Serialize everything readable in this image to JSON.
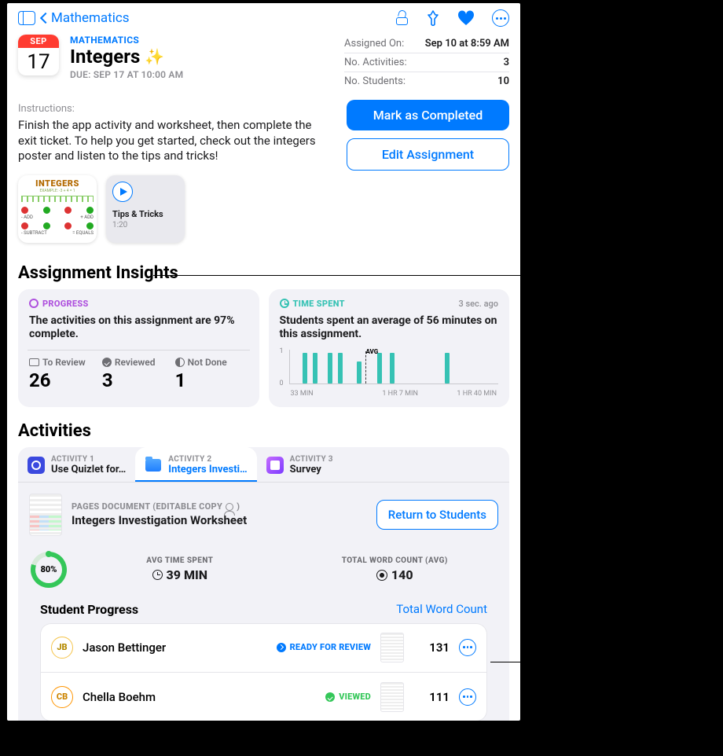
{
  "nav": {
    "back_label": "Mathematics"
  },
  "calendar": {
    "month": "SEP",
    "day": "17"
  },
  "header": {
    "eyebrow": "MATHEMATICS",
    "title": "Integers",
    "due": "DUE: SEP 17 AT 10:00 AM"
  },
  "meta": {
    "assigned_label": "Assigned On:",
    "assigned_value": "Sep 10 at 8:59 AM",
    "activities_label": "No. Activities:",
    "activities_value": "3",
    "students_label": "No. Students:",
    "students_value": "10"
  },
  "buttons": {
    "complete": "Mark as Completed",
    "edit": "Edit Assignment",
    "return_students": "Return to Students"
  },
  "instructions": {
    "label": "Instructions:",
    "text": "Finish the app activity and worksheet, then complete the exit ticket. To help you get started, check out the integers poster and listen to the tips and tricks!"
  },
  "attachments": {
    "poster_title": "INTEGERS",
    "audio_title": "Tips & Tricks",
    "audio_duration": "1:20"
  },
  "sections": {
    "insights": "Assignment Insights",
    "activities": "Activities",
    "student_progress": "Student Progress",
    "total_word_count": "Total Word Count"
  },
  "insights": {
    "progress": {
      "badge": "PROGRESS",
      "headline": "The activities on this assignment are 97% complete.",
      "to_review_label": "To Review",
      "to_review": "26",
      "reviewed_label": "Reviewed",
      "reviewed": "3",
      "not_done_label": "Not Done",
      "not_done": "1"
    },
    "time": {
      "badge": "TIME SPENT",
      "ago": "3 sec. ago",
      "headline": "Students spent an average of 56 minutes on this assignment.",
      "y1": "1",
      "y0": "0",
      "avg_label": "AVG",
      "x_min": "33 MIN",
      "x_mid": "1 HR 7 MIN",
      "x_max": "1 HR 40 MIN"
    }
  },
  "tabs": {
    "a1_k": "ACTIVITY 1",
    "a1_t": "Use Quizlet for…",
    "a2_k": "ACTIVITY 2",
    "a2_t": "Integers Investi…",
    "a3_k": "ACTIVITY 3",
    "a3_t": "Survey"
  },
  "doc": {
    "kicker": "PAGES DOCUMENT (EDITABLE COPY",
    "kicker_end": ")",
    "title": "Integers Investigation Worksheet"
  },
  "metrics": {
    "ring_pct": "80%",
    "avg_time_label": "AVG TIME SPENT",
    "avg_time_value": "39 MIN",
    "wc_label": "TOTAL WORD COUNT (AVG)",
    "wc_value": "140"
  },
  "students": {
    "s1": {
      "initials": "JB",
      "name": "Jason Bettinger",
      "status": "READY FOR REVIEW",
      "count": "131"
    },
    "s2": {
      "initials": "CB",
      "name": "Chella Boehm",
      "status": "VIEWED",
      "count": "111"
    }
  }
}
